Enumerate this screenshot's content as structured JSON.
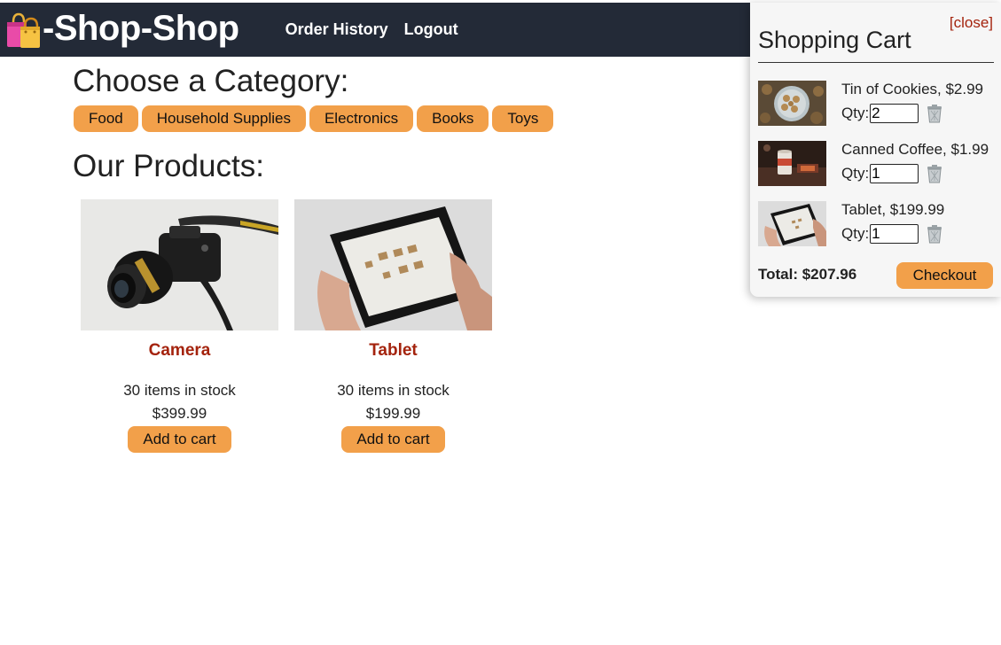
{
  "header": {
    "brand_icon": "shopping-bags-icon",
    "brand_name": "-Shop-Shop",
    "nav": [
      "Order History",
      "Logout"
    ],
    "background": "#232a37"
  },
  "categories": {
    "heading": "Choose a Category:",
    "items": [
      "Food",
      "Household Supplies",
      "Electronics",
      "Books",
      "Toys"
    ]
  },
  "products": {
    "heading": "Our Products:",
    "items": [
      {
        "name": "Camera",
        "image": "camera-photo",
        "stock": "30 items in stock",
        "price": "$399.99",
        "button": "Add to cart"
      },
      {
        "name": "Tablet",
        "image": "tablet-photo",
        "stock": "30 items in stock",
        "price": "$199.99",
        "button": "Add to cart"
      }
    ]
  },
  "cart": {
    "close_label": "[close]",
    "title": "Shopping Cart",
    "qty_label": "Qty:",
    "items": [
      {
        "description": "Tin of Cookies, $2.99",
        "qty": "2",
        "image": "cookies-photo"
      },
      {
        "description": "Canned Coffee, $1.99",
        "qty": "1",
        "image": "coffee-photo"
      },
      {
        "description": "Tablet, $199.99",
        "qty": "1",
        "image": "tablet-photo"
      }
    ],
    "total": "Total: $207.96",
    "checkout_label": "Checkout"
  },
  "colors": {
    "accent_button": "#f2a04a",
    "product_name": "#a4230d",
    "close_link": "#a4230d"
  }
}
